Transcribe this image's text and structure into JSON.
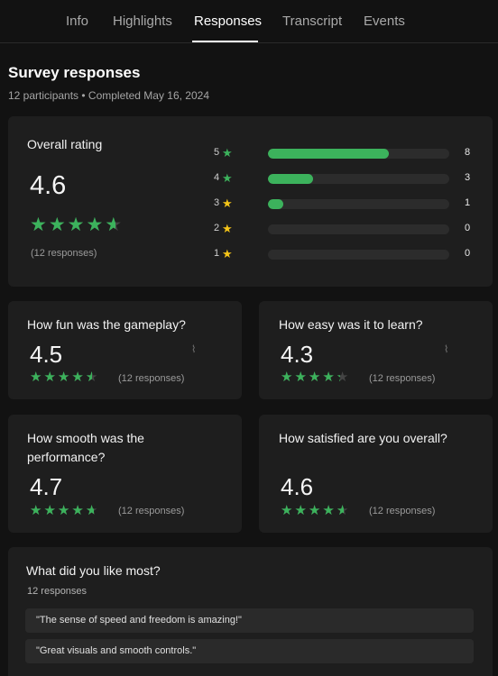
{
  "tabs": [
    {
      "label": "Info"
    },
    {
      "label": "Highlights"
    },
    {
      "label": "Responses"
    },
    {
      "label": "Transcript"
    },
    {
      "label": "Events"
    }
  ],
  "active_tab": "Responses",
  "page": {
    "title": "Survey responses",
    "meta": "12 participants • Completed May 16, 2024"
  },
  "overall": {
    "label": "Overall rating",
    "score": "4.6",
    "score_value": 4.6,
    "responses": "(12 responses)",
    "distribution": [
      {
        "stars": "5",
        "count": 8,
        "count_label": "8",
        "fraction": 0.667,
        "star_color": "#3cb25c"
      },
      {
        "stars": "4",
        "count": 3,
        "count_label": "3",
        "fraction": 0.25,
        "star_color": "#3cb25c"
      },
      {
        "stars": "3",
        "count": 1,
        "count_label": "1",
        "fraction": 0.083,
        "star_color": "#f5c518"
      },
      {
        "stars": "2",
        "count": 0,
        "count_label": "0",
        "fraction": 0,
        "star_color": "#f5c518"
      },
      {
        "stars": "1",
        "count": 0,
        "count_label": "0",
        "fraction": 0,
        "star_color": "#f5c518"
      }
    ]
  },
  "questions": [
    {
      "question": "How fun was the gameplay?",
      "score": "4.5",
      "score_value": 4.5,
      "responses": "(12 responses)",
      "icon": "cursor-icon"
    },
    {
      "question": "How easy was it to learn?",
      "score": "4.3",
      "score_value": 4.3,
      "responses": "(12 responses)",
      "icon": "cursor-icon"
    },
    {
      "question": "How smooth was the performance?",
      "score": "4.7",
      "score_value": 4.7,
      "responses": "(12 responses)"
    },
    {
      "question": "How satisfied are you overall?",
      "score": "4.6",
      "score_value": 4.6,
      "responses": "(12 responses)"
    }
  ],
  "open_question": {
    "question": "What did you like most?",
    "responses": "12 responses",
    "answers": [
      "\"The sense of speed and freedom is amazing!\"",
      "\"Great visuals and smooth controls.\""
    ]
  },
  "colors": {
    "accent_green": "#3cb25c",
    "star_yellow": "#f5c518",
    "background": "#121212",
    "card": "#1e1e1e"
  }
}
